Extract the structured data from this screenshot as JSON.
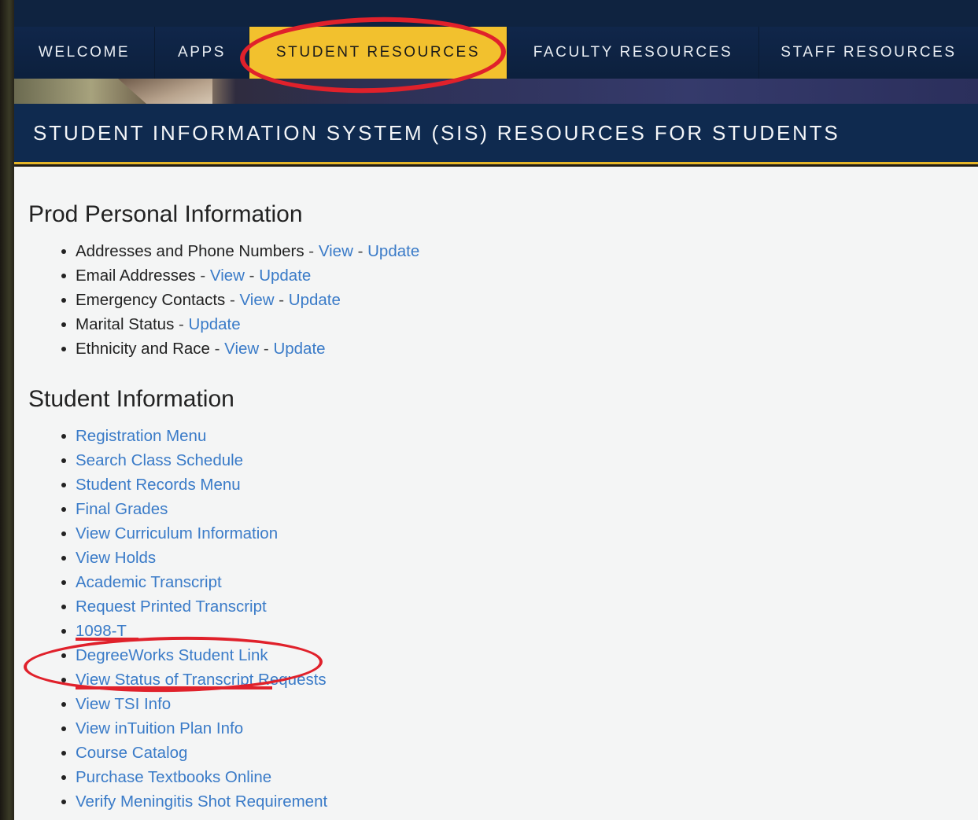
{
  "nav": {
    "items": [
      {
        "label": "WELCOME",
        "active": false
      },
      {
        "label": "APPS",
        "active": false
      },
      {
        "label": "STUDENT RESOURCES",
        "active": true
      },
      {
        "label": "FACULTY RESOURCES",
        "active": false
      },
      {
        "label": "STAFF RESOURCES",
        "active": false
      }
    ]
  },
  "page": {
    "title": "STUDENT INFORMATION SYSTEM (SIS) RESOURCES FOR STUDENTS"
  },
  "personal": {
    "heading": "Prod Personal Information",
    "items": [
      {
        "label": "Addresses and Phone Numbers",
        "sep": " - ",
        "view": "View",
        "sep2": " - ",
        "update": "Update"
      },
      {
        "label": "Email Addresses",
        "sep": " - ",
        "view": "View",
        "sep2": " - ",
        "update": "Update"
      },
      {
        "label": "Emergency Contacts",
        "sep": " - ",
        "view": "View",
        "sep2": " - ",
        "update": "Update"
      },
      {
        "label": "Marital Status",
        "sep": " - ",
        "update": "Update"
      },
      {
        "label": "Ethnicity and Race",
        "sep": " - ",
        "view": "View",
        "sep2": " - ",
        "update": "Update"
      }
    ]
  },
  "student": {
    "heading": "Student Information",
    "links": [
      "Registration Menu",
      "Search Class Schedule",
      "Student Records Menu",
      "Final Grades",
      "View Curriculum Information",
      "View Holds",
      "Academic Transcript",
      "Request Printed Transcript",
      "1098-T",
      "DegreeWorks Student Link",
      "View Status of Transcript Requests",
      "View TSI Info",
      "View inTuition Plan Info",
      "Course Catalog",
      "Purchase Textbooks Online",
      "Verify Meningitis Shot Requirement"
    ]
  },
  "colors": {
    "nav_bg": "#0c203d",
    "active_tab": "#f2c12e",
    "link": "#3a7bc8",
    "annotation": "#e0212b"
  }
}
